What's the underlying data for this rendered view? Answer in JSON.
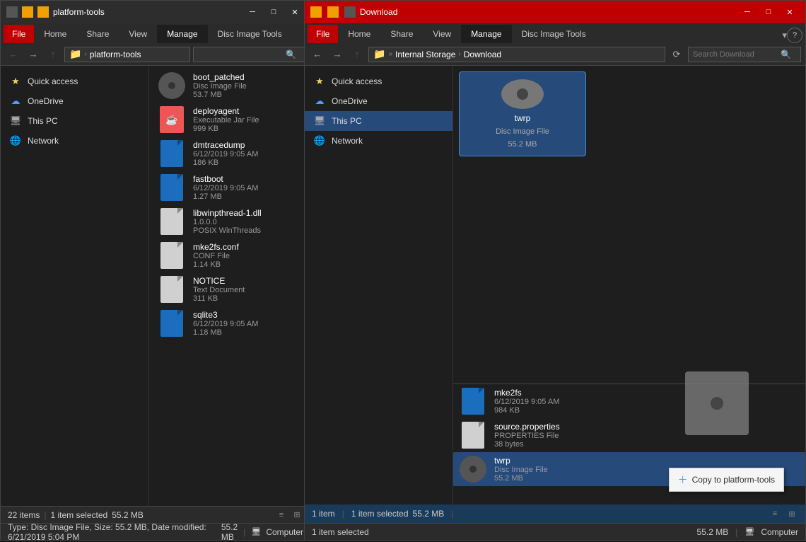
{
  "leftWindow": {
    "title": "platform-tools",
    "titleBarState": "inactive",
    "tabs": {
      "file": "File",
      "home": "Home",
      "share": "Share",
      "view": "View",
      "manage": "Manage",
      "discImageTools": "Disc Image Tools"
    },
    "addressBar": {
      "path": "platform-tools",
      "fullPath": "> platform-tools"
    },
    "searchPlaceholder": "",
    "sidebar": {
      "items": [
        {
          "id": "quick-access",
          "label": "Quick access",
          "icon": "star",
          "expanded": true
        },
        {
          "id": "onedrive",
          "label": "OneDrive",
          "icon": "cloud"
        },
        {
          "id": "this-pc",
          "label": "This PC",
          "icon": "pc"
        },
        {
          "id": "network",
          "label": "Network",
          "icon": "network"
        }
      ]
    },
    "files": [
      {
        "name": "boot_patched",
        "type": "Disc Image File",
        "size": "53.7 MB",
        "iconType": "disc"
      },
      {
        "name": "deployagent",
        "type": "Executable Jar File",
        "size": "999 KB",
        "iconType": "java"
      },
      {
        "name": "dmtracedump",
        "type": "",
        "date": "6/12/2019 9:05 AM",
        "size": "186 KB",
        "iconType": "blue"
      },
      {
        "name": "fastboot",
        "type": "",
        "date": "6/12/2019 9:05 AM",
        "size": "1.27 MB",
        "iconType": "blue"
      },
      {
        "name": "libwinpthread-1.dll",
        "type": "1.0.0.0",
        "meta": "POSIX WinThreads",
        "size": "",
        "iconType": "white"
      },
      {
        "name": "mke2fs.conf",
        "type": "CONF File",
        "size": "1.14 KB",
        "iconType": "white"
      },
      {
        "name": "NOTICE",
        "type": "Text Document",
        "size": "311 KB",
        "iconType": "white"
      },
      {
        "name": "sqlite3",
        "type": "",
        "date": "6/12/2019 9:05 AM",
        "size": "1.18 MB",
        "iconType": "blue"
      }
    ],
    "statusBar": {
      "itemCount": "22 items",
      "selectedInfo": "1 item selected",
      "selectedSize": "55.2 MB"
    },
    "typeBar": {
      "text": "Type: Disc Image File, Size: 55.2 MB, Date modified: 6/21/2019 5:04 PM",
      "sizeRight": "55.2 MB",
      "computerRight": "Computer"
    }
  },
  "rightWindow": {
    "title": "Download",
    "titleBarState": "active",
    "tabs": {
      "file": "File",
      "home": "Home",
      "share": "Share",
      "view": "View",
      "manage": "Manage",
      "discImageTools": "Disc Image Tools"
    },
    "addressBar": {
      "internalStorage": "Internal Storage",
      "download": "Download"
    },
    "searchPlaceholder": "Search Download",
    "sidebar": {
      "items": [
        {
          "id": "quick-access",
          "label": "Quick access",
          "icon": "star"
        },
        {
          "id": "onedrive",
          "label": "OneDrive",
          "icon": "cloud"
        },
        {
          "id": "this-pc",
          "label": "This PC",
          "icon": "pc",
          "active": true
        },
        {
          "id": "network",
          "label": "Network",
          "icon": "network"
        }
      ]
    },
    "mainFile": {
      "name": "twrp",
      "type": "Disc Image File",
      "size": "55.2 MB",
      "iconType": "disc"
    },
    "bottomFiles": [
      {
        "name": "mke2fs",
        "date": "6/12/2019 9:05 AM",
        "size": "984 KB",
        "iconType": "blue"
      },
      {
        "name": "source.properties",
        "type": "PROPERTIES File",
        "size": "38 bytes",
        "iconType": "white"
      },
      {
        "name": "twrp",
        "type": "Disc Image File",
        "size": "55.2 MB",
        "iconType": "disc",
        "selected": true
      }
    ],
    "overlayStatus": {
      "itemCount": "1 item",
      "separator1": "|",
      "selectedInfo": "1 item selected",
      "selectedSize": "55.2 MB",
      "separator2": "|"
    },
    "dragStatus": {
      "selectedInfo": "1 item selected",
      "size": "55.2 MB",
      "computer": "Computer"
    },
    "copyTooltip": {
      "text": "Copy to platform-tools"
    },
    "statusBar": {
      "sizeRight": "55.2 MB",
      "computerRight": "Computer"
    }
  },
  "icons": {
    "back": "←",
    "forward": "→",
    "up": "↑",
    "refresh": "⟳",
    "search": "🔍",
    "minimize": "─",
    "maximize": "□",
    "close": "✕",
    "expand": "▾",
    "chevronRight": "›",
    "star": "★",
    "cloud": "☁",
    "pc": "💻",
    "network": "🌐",
    "copy": "📋",
    "viewList": "≡",
    "viewDetails": "⊞"
  }
}
